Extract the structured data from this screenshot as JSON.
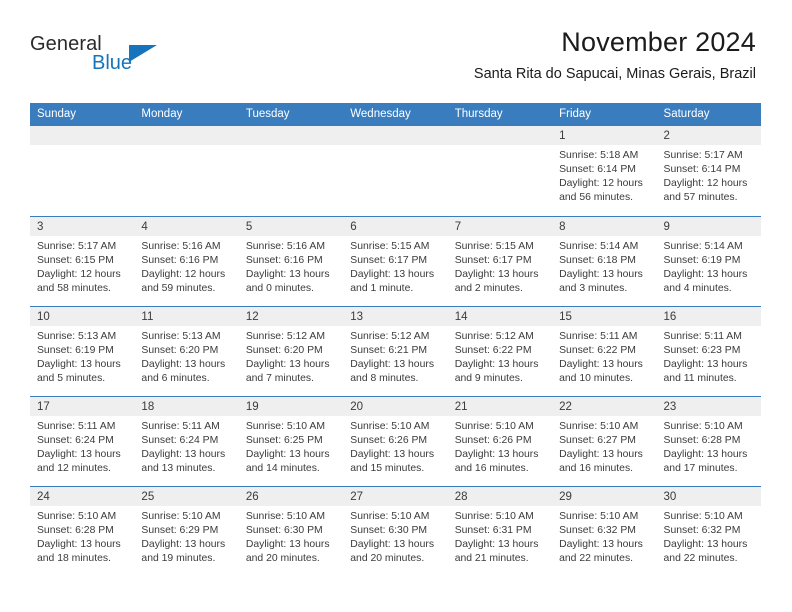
{
  "brand": {
    "word_one": "General",
    "word_two": "Blue",
    "accent_color": "#1574bb",
    "triangle_icon": "triangle-icon"
  },
  "header": {
    "title": "November 2024",
    "subtitle": "Santa Rita do Sapucai, Minas Gerais, Brazil"
  },
  "calendar": {
    "header_bg": "#3a7dbf",
    "datenum_bg": "#efefef",
    "weekday_headers": [
      "Sunday",
      "Monday",
      "Tuesday",
      "Wednesday",
      "Thursday",
      "Friday",
      "Saturday"
    ],
    "weeks": [
      [
        {
          "date": "",
          "lines": []
        },
        {
          "date": "",
          "lines": []
        },
        {
          "date": "",
          "lines": []
        },
        {
          "date": "",
          "lines": []
        },
        {
          "date": "",
          "lines": []
        },
        {
          "date": "1",
          "lines": [
            "Sunrise: 5:18 AM",
            "Sunset: 6:14 PM",
            "Daylight: 12 hours",
            "and 56 minutes."
          ]
        },
        {
          "date": "2",
          "lines": [
            "Sunrise: 5:17 AM",
            "Sunset: 6:14 PM",
            "Daylight: 12 hours",
            "and 57 minutes."
          ]
        }
      ],
      [
        {
          "date": "3",
          "lines": [
            "Sunrise: 5:17 AM",
            "Sunset: 6:15 PM",
            "Daylight: 12 hours",
            "and 58 minutes."
          ]
        },
        {
          "date": "4",
          "lines": [
            "Sunrise: 5:16 AM",
            "Sunset: 6:16 PM",
            "Daylight: 12 hours",
            "and 59 minutes."
          ]
        },
        {
          "date": "5",
          "lines": [
            "Sunrise: 5:16 AM",
            "Sunset: 6:16 PM",
            "Daylight: 13 hours",
            "and 0 minutes."
          ]
        },
        {
          "date": "6",
          "lines": [
            "Sunrise: 5:15 AM",
            "Sunset: 6:17 PM",
            "Daylight: 13 hours",
            "and 1 minute."
          ]
        },
        {
          "date": "7",
          "lines": [
            "Sunrise: 5:15 AM",
            "Sunset: 6:17 PM",
            "Daylight: 13 hours",
            "and 2 minutes."
          ]
        },
        {
          "date": "8",
          "lines": [
            "Sunrise: 5:14 AM",
            "Sunset: 6:18 PM",
            "Daylight: 13 hours",
            "and 3 minutes."
          ]
        },
        {
          "date": "9",
          "lines": [
            "Sunrise: 5:14 AM",
            "Sunset: 6:19 PM",
            "Daylight: 13 hours",
            "and 4 minutes."
          ]
        }
      ],
      [
        {
          "date": "10",
          "lines": [
            "Sunrise: 5:13 AM",
            "Sunset: 6:19 PM",
            "Daylight: 13 hours",
            "and 5 minutes."
          ]
        },
        {
          "date": "11",
          "lines": [
            "Sunrise: 5:13 AM",
            "Sunset: 6:20 PM",
            "Daylight: 13 hours",
            "and 6 minutes."
          ]
        },
        {
          "date": "12",
          "lines": [
            "Sunrise: 5:12 AM",
            "Sunset: 6:20 PM",
            "Daylight: 13 hours",
            "and 7 minutes."
          ]
        },
        {
          "date": "13",
          "lines": [
            "Sunrise: 5:12 AM",
            "Sunset: 6:21 PM",
            "Daylight: 13 hours",
            "and 8 minutes."
          ]
        },
        {
          "date": "14",
          "lines": [
            "Sunrise: 5:12 AM",
            "Sunset: 6:22 PM",
            "Daylight: 13 hours",
            "and 9 minutes."
          ]
        },
        {
          "date": "15",
          "lines": [
            "Sunrise: 5:11 AM",
            "Sunset: 6:22 PM",
            "Daylight: 13 hours",
            "and 10 minutes."
          ]
        },
        {
          "date": "16",
          "lines": [
            "Sunrise: 5:11 AM",
            "Sunset: 6:23 PM",
            "Daylight: 13 hours",
            "and 11 minutes."
          ]
        }
      ],
      [
        {
          "date": "17",
          "lines": [
            "Sunrise: 5:11 AM",
            "Sunset: 6:24 PM",
            "Daylight: 13 hours",
            "and 12 minutes."
          ]
        },
        {
          "date": "18",
          "lines": [
            "Sunrise: 5:11 AM",
            "Sunset: 6:24 PM",
            "Daylight: 13 hours",
            "and 13 minutes."
          ]
        },
        {
          "date": "19",
          "lines": [
            "Sunrise: 5:10 AM",
            "Sunset: 6:25 PM",
            "Daylight: 13 hours",
            "and 14 minutes."
          ]
        },
        {
          "date": "20",
          "lines": [
            "Sunrise: 5:10 AM",
            "Sunset: 6:26 PM",
            "Daylight: 13 hours",
            "and 15 minutes."
          ]
        },
        {
          "date": "21",
          "lines": [
            "Sunrise: 5:10 AM",
            "Sunset: 6:26 PM",
            "Daylight: 13 hours",
            "and 16 minutes."
          ]
        },
        {
          "date": "22",
          "lines": [
            "Sunrise: 5:10 AM",
            "Sunset: 6:27 PM",
            "Daylight: 13 hours",
            "and 16 minutes."
          ]
        },
        {
          "date": "23",
          "lines": [
            "Sunrise: 5:10 AM",
            "Sunset: 6:28 PM",
            "Daylight: 13 hours",
            "and 17 minutes."
          ]
        }
      ],
      [
        {
          "date": "24",
          "lines": [
            "Sunrise: 5:10 AM",
            "Sunset: 6:28 PM",
            "Daylight: 13 hours",
            "and 18 minutes."
          ]
        },
        {
          "date": "25",
          "lines": [
            "Sunrise: 5:10 AM",
            "Sunset: 6:29 PM",
            "Daylight: 13 hours",
            "and 19 minutes."
          ]
        },
        {
          "date": "26",
          "lines": [
            "Sunrise: 5:10 AM",
            "Sunset: 6:30 PM",
            "Daylight: 13 hours",
            "and 20 minutes."
          ]
        },
        {
          "date": "27",
          "lines": [
            "Sunrise: 5:10 AM",
            "Sunset: 6:30 PM",
            "Daylight: 13 hours",
            "and 20 minutes."
          ]
        },
        {
          "date": "28",
          "lines": [
            "Sunrise: 5:10 AM",
            "Sunset: 6:31 PM",
            "Daylight: 13 hours",
            "and 21 minutes."
          ]
        },
        {
          "date": "29",
          "lines": [
            "Sunrise: 5:10 AM",
            "Sunset: 6:32 PM",
            "Daylight: 13 hours",
            "and 22 minutes."
          ]
        },
        {
          "date": "30",
          "lines": [
            "Sunrise: 5:10 AM",
            "Sunset: 6:32 PM",
            "Daylight: 13 hours",
            "and 22 minutes."
          ]
        }
      ]
    ]
  }
}
